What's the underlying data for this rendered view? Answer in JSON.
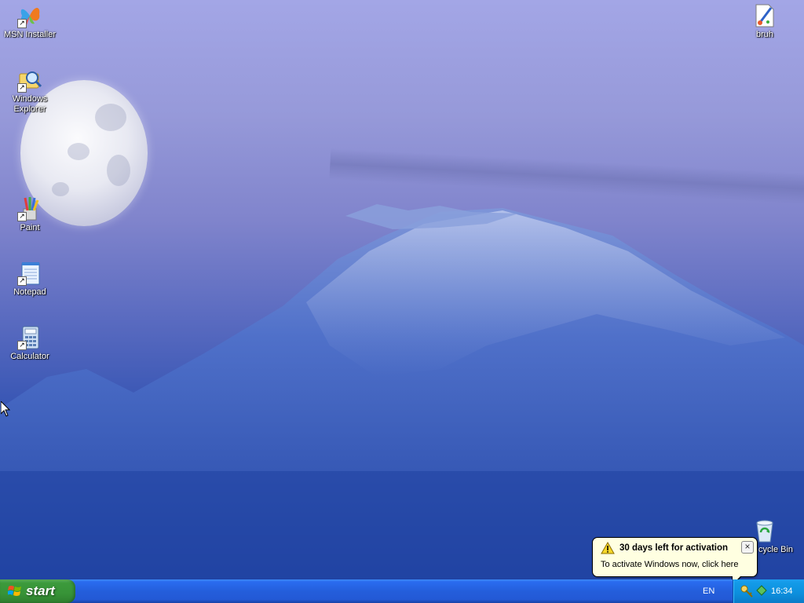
{
  "desktop": {
    "icons": [
      {
        "label": "MSN Installer",
        "icon": "msn-butterfly-icon"
      },
      {
        "label": "Windows Explorer",
        "icon": "explorer-magnifier-folder-icon"
      },
      {
        "label": "Paint",
        "icon": "paint-brushes-icon"
      },
      {
        "label": "Notepad",
        "icon": "notepad-icon"
      },
      {
        "label": "Calculator",
        "icon": "calculator-icon"
      },
      {
        "label": "bruh",
        "icon": "paint-file-icon"
      },
      {
        "label": "cycle Bin",
        "icon": "recycle-bin-icon"
      }
    ]
  },
  "balloon": {
    "title": "30 days left for activation",
    "message": "To activate Windows now, click here",
    "icon": "warning-icon"
  },
  "taskbar": {
    "start_label": "start",
    "language": "EN",
    "clock": "16:34"
  },
  "colors": {
    "taskbar_blue": "#245edb",
    "start_green": "#379337",
    "tray_blue": "#0c8fdd",
    "balloon_bg": "#ffffe1"
  }
}
